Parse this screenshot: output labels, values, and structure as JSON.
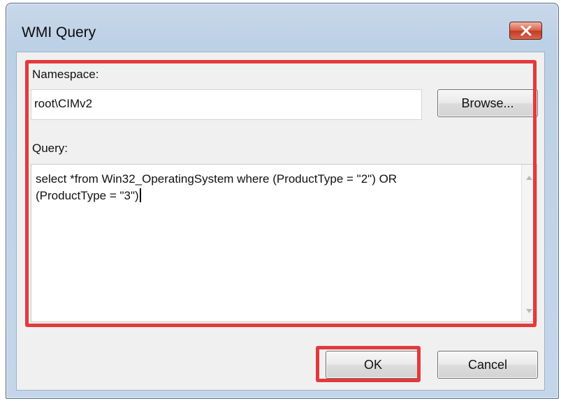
{
  "window": {
    "title": "WMI Query"
  },
  "namespace": {
    "label": "Namespace:",
    "value": "root\\CIMv2",
    "browse_label": "Browse..."
  },
  "query": {
    "label": "Query:",
    "value": "select *from Win32_OperatingSystem where (ProductType = \"2\") OR\n(ProductType = \"3\")"
  },
  "buttons": {
    "ok_label": "OK",
    "cancel_label": "Cancel"
  },
  "colors": {
    "highlight": "#e4393c",
    "close_button": "#c23a22"
  },
  "icons": {
    "close": "close-icon",
    "scroll_up": "scroll-up-arrow-icon",
    "scroll_down": "scroll-down-arrow-icon"
  }
}
